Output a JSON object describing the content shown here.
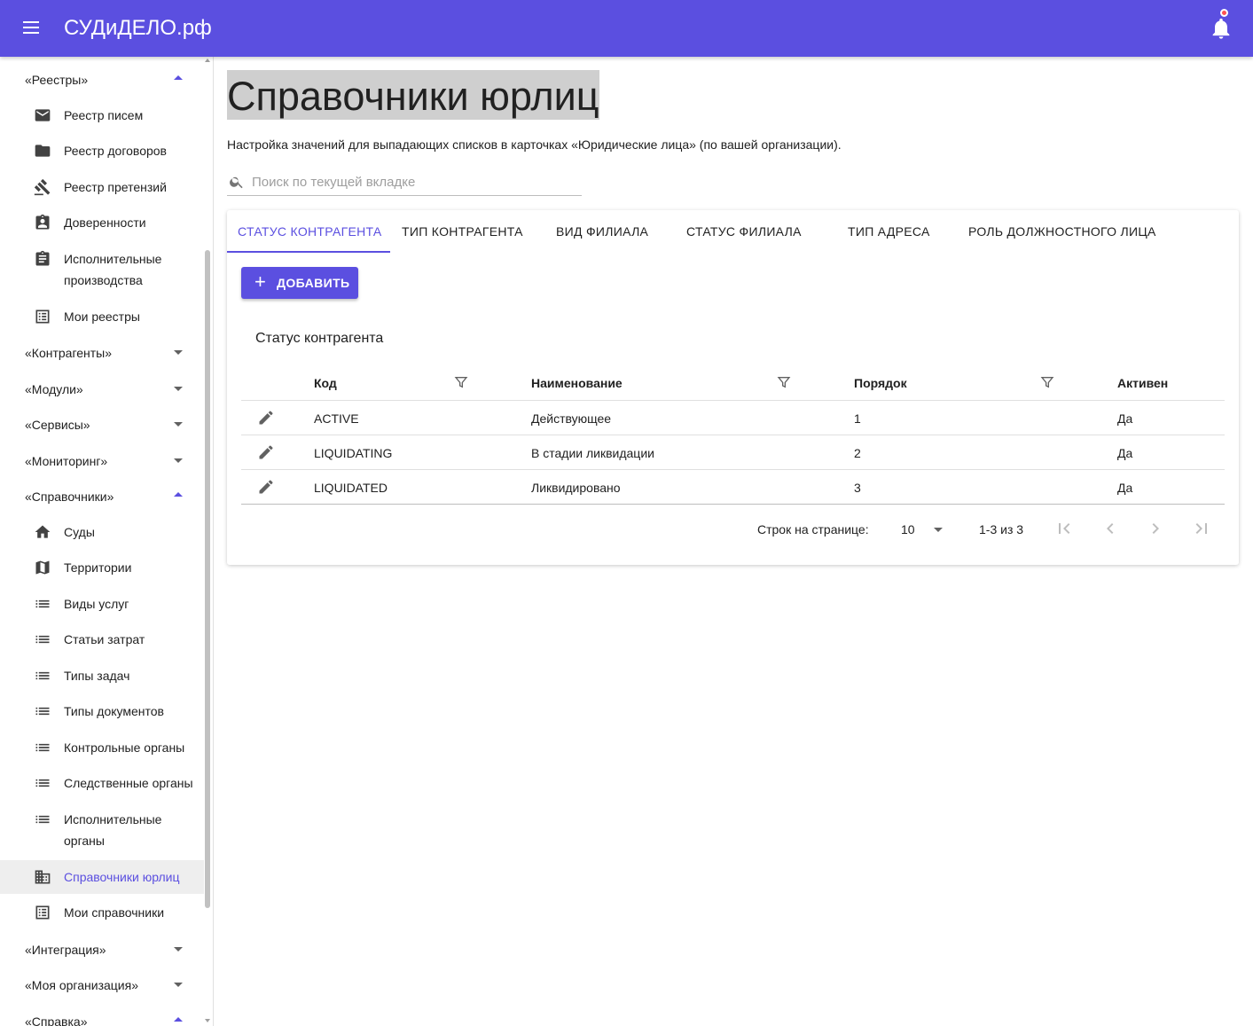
{
  "appbar": {
    "title": "СУДиДЕЛО.рф"
  },
  "sidebar": {
    "groups": {
      "registries": "«Реестры»",
      "counterparties": "«Контрагенты»",
      "modules": "«Модули»",
      "services": "«Сервисы»",
      "monitoring": "«Мониторинг»",
      "references": "«Справочники»",
      "integration": "«Интеграция»",
      "my_org": "«Моя организация»",
      "help": "«Справка»"
    },
    "registry_items": [
      "Реестр писем",
      "Реестр договоров",
      "Реестр претензий",
      "Доверенности",
      "Исполнительные производства",
      "Мои реестры"
    ],
    "reference_items": [
      "Суды",
      "Территории",
      "Виды услуг",
      "Статьи затрат",
      "Типы задач",
      "Типы документов",
      "Контрольные органы",
      "Следственные органы",
      "Исполнительные органы",
      "Справочники юрлиц",
      "Мои справочники"
    ]
  },
  "main": {
    "title": "Справочники юрлиц",
    "description": "Настройка значений для выпадающих списков в карточках «Юридические лица» (по вашей организации).",
    "search_placeholder": "Поиск по текущей вкладке",
    "tabs": [
      "Статус контрагента",
      "Тип контрагента",
      "Вид филиала",
      "Статус филиала",
      "Тип адреса",
      "Роль должностного лица"
    ],
    "add_label": "Добавить",
    "table_title": "Статус контрагента",
    "columns": [
      "Код",
      "Наименование",
      "Порядок",
      "Активен"
    ],
    "rows": [
      {
        "code": "ACTIVE",
        "name": "Действующее",
        "order": "1",
        "active": "Да"
      },
      {
        "code": "LIQUIDATING",
        "name": "В стадии ликвидации",
        "order": "2",
        "active": "Да"
      },
      {
        "code": "LIQUIDATED",
        "name": "Ликвидировано",
        "order": "3",
        "active": "Да"
      }
    ],
    "pager": {
      "rows_label": "Строк на странице:",
      "rows_value": "10",
      "range": "1-3 из 3"
    }
  },
  "colors": {
    "accent": "#5b4fe0",
    "notification": "#ff5252"
  },
  "icons": [
    "menu-icon",
    "bell-icon",
    "mail-icon",
    "folder-icon",
    "gavel-icon",
    "badge-icon",
    "clipboard-icon",
    "list-box-icon",
    "home-icon",
    "map-icon",
    "list-icon",
    "building-icon",
    "search-icon",
    "plus-icon",
    "filter-icon",
    "pencil-icon",
    "first-page-icon",
    "prev-page-icon",
    "next-page-icon",
    "last-page-icon"
  ]
}
